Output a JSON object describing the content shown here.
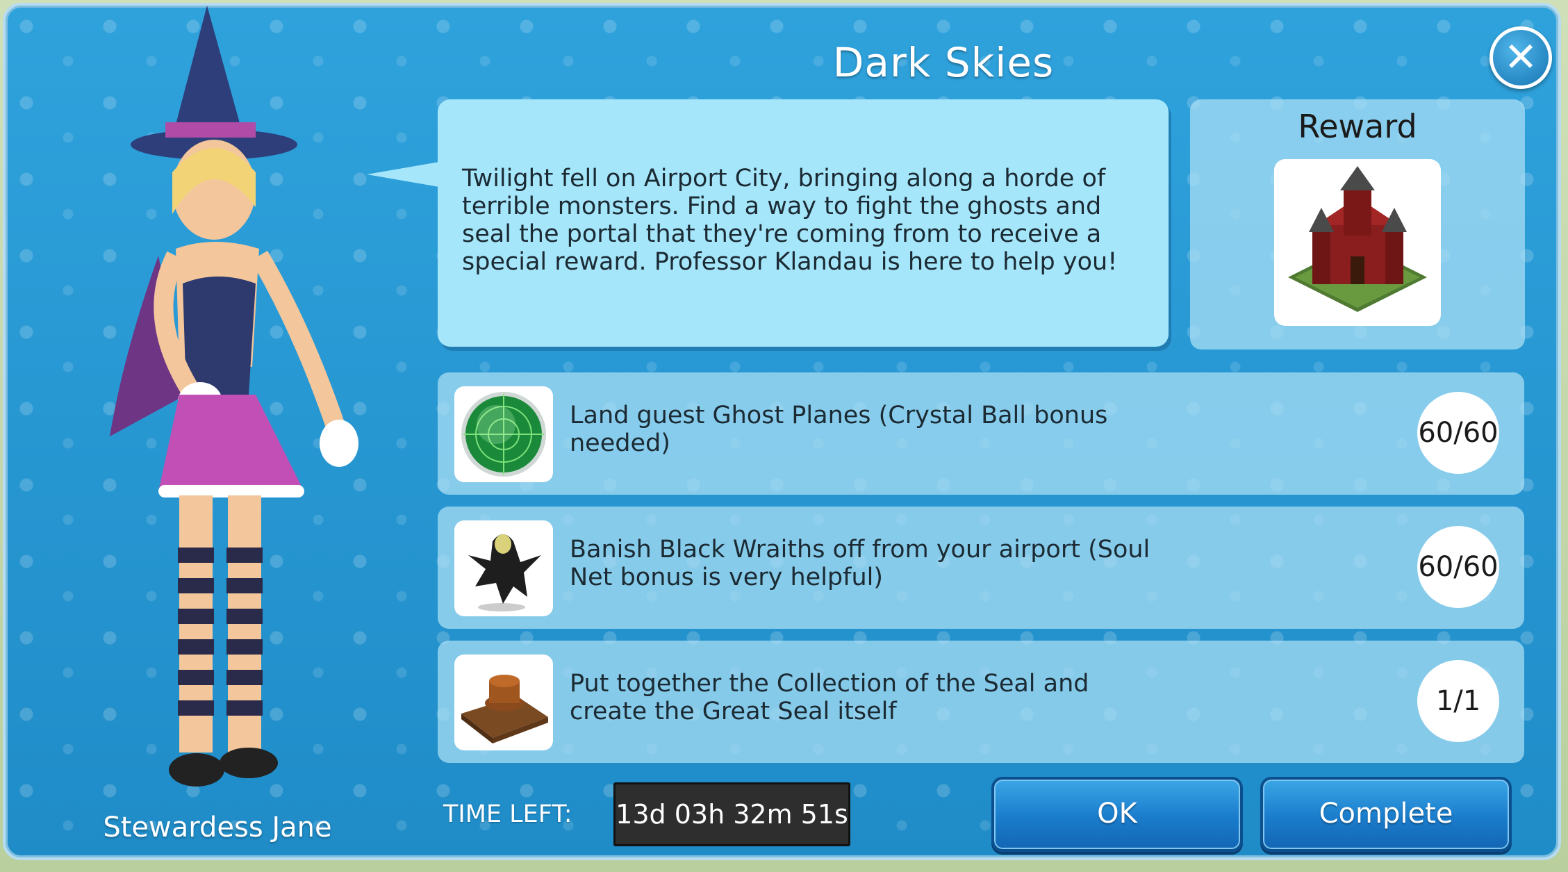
{
  "dialog": {
    "title": "Dark Skies",
    "close_icon": "close-icon"
  },
  "character": {
    "name": "Stewardess Jane"
  },
  "bubble": {
    "text": "Twilight fell on Airport City, bringing along a horde of terrible monsters. Find a way to fight the ghosts and seal the portal that they're coming from to receive a special reward. Professor Klandau is here to help you!"
  },
  "reward": {
    "title": "Reward",
    "image": "castle-image"
  },
  "tasks": [
    {
      "icon": "radar-icon",
      "text": "Land guest Ghost Planes (Crystal Ball bonus needed)",
      "count": "60/60"
    },
    {
      "icon": "wraith-icon",
      "text": "Banish Black Wraiths off from your airport (Soul Net bonus is very helpful)",
      "count": "60/60"
    },
    {
      "icon": "seal-icon",
      "text": "Put together the Collection of the Seal and create the Great Seal itself",
      "count": "1/1"
    }
  ],
  "footer": {
    "time_label": "TIME LEFT:",
    "time_value": "13d 03h 32m 51s",
    "ok_label": "OK",
    "complete_label": "Complete"
  }
}
